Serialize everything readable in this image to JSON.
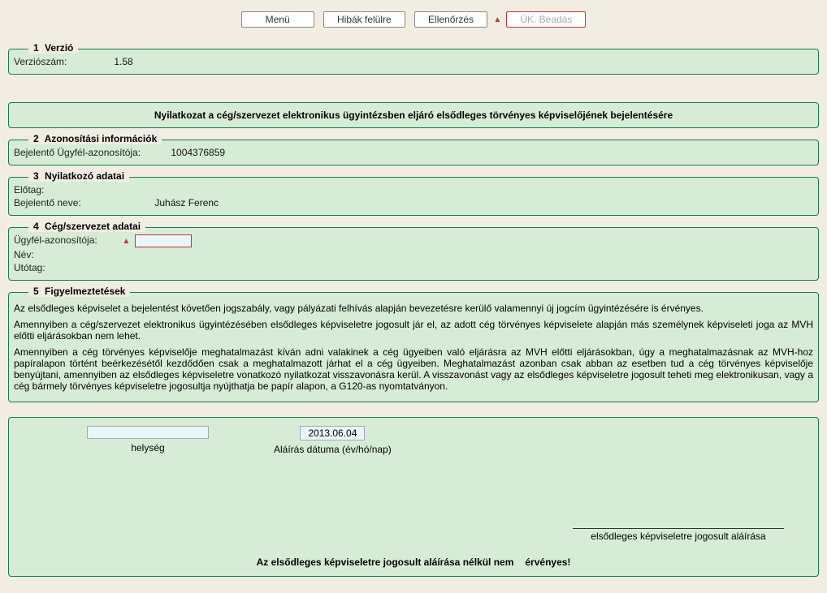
{
  "toolbar": {
    "menu": "Menü",
    "errors_up": "Hibák felülre",
    "check": "Ellenőrzés",
    "submit": "ÜK. Beadás"
  },
  "sections": {
    "s1": {
      "num": "1",
      "title": "Verzió",
      "version_lbl": "Verziószám:",
      "version_val": "1.58"
    },
    "title_block": "Nyilatkozat a cég/szervezet elektronikus ügyintézsben eljáró elsődleges törvényes képviselőjének bejelentésére",
    "s2": {
      "num": "2",
      "title": "Azonosítási információk",
      "client_id_lbl": "Bejelentő Ügyfél-azonosítója:",
      "client_id_val": "1004376859"
    },
    "s3": {
      "num": "3",
      "title": "Nyilatkozó adatai",
      "prefix_lbl": "Előtag:",
      "name_lbl": "Bejelentő neve:",
      "name_val": "Juhász Ferenc"
    },
    "s4": {
      "num": "4",
      "title": "Cég/szervezet adatai",
      "client_id_lbl": "Ügyfél-azonosítója:",
      "name_lbl": "Név:",
      "suffix_lbl": "Utótag:"
    },
    "s5": {
      "num": "5",
      "title": "Figyelmeztetések",
      "p1": "Az elsődleges képviselet a bejelentést követően jogszabály, vagy pályázati felhívás alapján bevezetésre kerülő valamennyi új jogcím ügyintézésére is érvényes.",
      "p2": "Amennyiben a cég/szervezet elektronikus ügyintézésében elsődleges képviseletre jogosult jár el, az adott cég törvényes képviselete alapján más személynek képviseleti joga az MVH előtti eljárásokban nem lehet.",
      "p3": "Amennyiben a cég törvényes képviselője meghatalmazást kíván adni valakinek a cég ügyeiben való eljárásra az MVH előtti eljárásokban, úgy a meghatalmazásnak az MVH-hoz papíralapon történt beérkezésétől kezdődően csak a meghatalmazott járhat el a cég ügyeiben. Meghatalmazást azonban csak abban az esetben tud a cég törvényes képviselője benyújtani, amennyiben az elsődleges képviseletre vonatkozó nyilatkozat visszavonásra kerül. A visszavonást vagy az elsődleges képviseletre jogosult teheti meg elektronikusan, vagy a cég bármely törvényes képviseletre jogosultja nyújthatja be papír alapon, a G120-as nyomtatványon."
    }
  },
  "signature": {
    "place_lbl": "helység",
    "date_lbl": "Aláírás dátuma (év/hó/nap)",
    "date_val": "2013.06.04",
    "sig_label": "elsődleges képviseletre jogosult aláírása",
    "footer_a": "Az elsődleges képviseletre jogosult aláírása nélkül nem",
    "footer_b": "érvényes!"
  }
}
